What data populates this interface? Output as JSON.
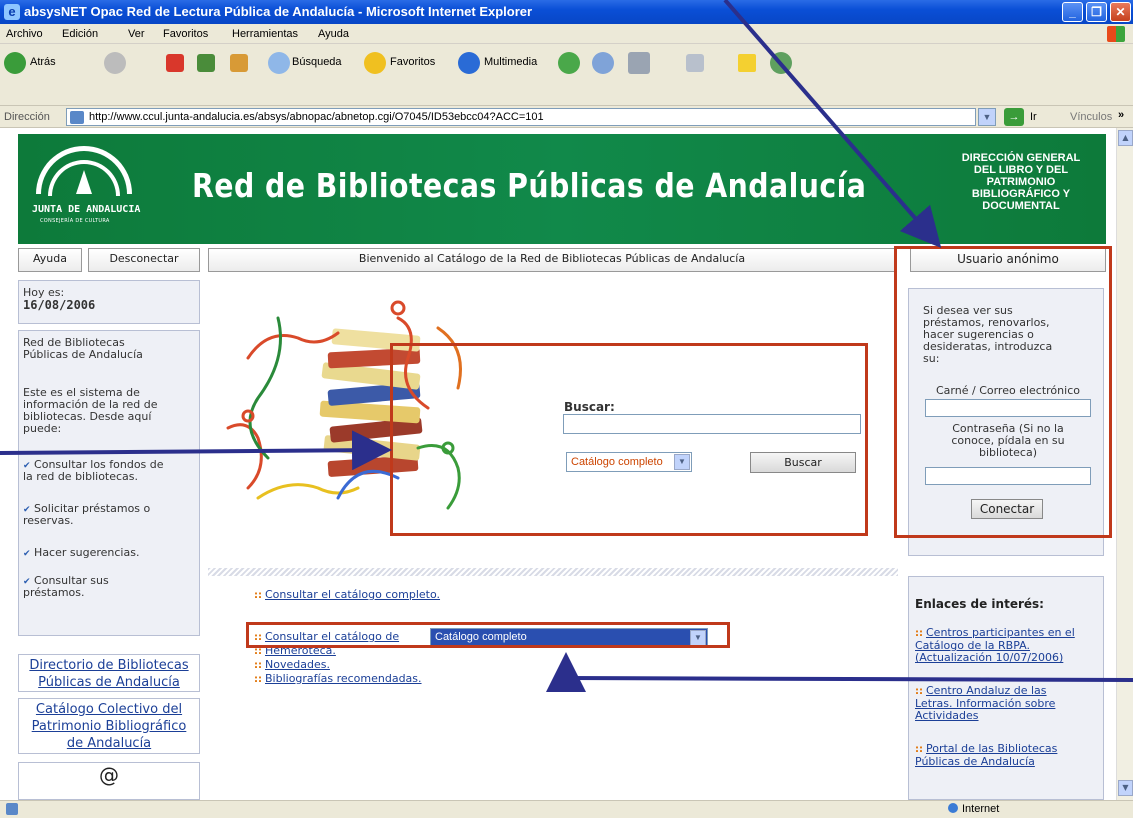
{
  "window": {
    "title": "absysNET Opac Red de Lectura Pública de Andalucía - Microsoft Internet Explorer",
    "minimize_glyph": "_",
    "restore_glyph": "❐",
    "close_glyph": "✕"
  },
  "menu": [
    "Archivo",
    "Edición",
    "Ver",
    "Favoritos",
    "Herramientas",
    "Ayuda"
  ],
  "toolbar": {
    "back": "Atrás",
    "search": "Búsqueda",
    "favorites": "Favoritos",
    "multimedia": "Multimedia"
  },
  "address": {
    "label": "Dirección",
    "url": "http://www.ccul.junta-andalucia.es/absys/abnopac/abnetop.cgi/O7045/ID53ebcc04?ACC=101",
    "go": "Ir",
    "links": "Vínculos",
    "more": "»"
  },
  "banner": {
    "logo_name": "JUNTA DE ANDALUCIA",
    "logo_sub": "CONSEJERÍA DE CULTURA",
    "title": "Red de Bibliotecas Públicas de Andalucía",
    "department": [
      "DIRECCIÓN GENERAL",
      "DEL LIBRO Y DEL",
      "PATRIMONIO",
      "BIBLIOGRÁFICO Y",
      "DOCUMENTAL"
    ]
  },
  "nav": {
    "help": "Ayuda",
    "logout": "Desconectar",
    "welcome": "Bienvenido al Catálogo de la Red de Bibliotecas Públicas de Andalucía",
    "user": "Usuario anónimo"
  },
  "left": {
    "today_label": "Hoy es:",
    "date": "16/08/2006",
    "network_name": [
      "Red de Bibliotecas",
      "Públicas de Andalucía"
    ],
    "intro": [
      "Este es el sistema de",
      "información de la red de",
      "bibliotecas. Desde aquí",
      "puede:"
    ],
    "features": [
      [
        "Consultar los fondos de",
        "la red de bibliotecas."
      ],
      [
        "Solicitar préstamos o",
        "reservas."
      ],
      [
        "Hacer sugerencias."
      ],
      [
        "Consultar sus",
        "préstamos."
      ]
    ],
    "tick": "✔",
    "directory_link": [
      "Directorio de Bibliotecas",
      "Públicas de Andalucía"
    ],
    "collective_link": [
      "Catálogo Colectivo del",
      "Patrimonio Bibliográfico",
      "de Andalucía"
    ],
    "at_symbol": "@"
  },
  "search": {
    "label": "Buscar:",
    "input_value": "",
    "catalog_option": "Catálogo completo",
    "button": "Buscar"
  },
  "center_links": {
    "bullet": "::",
    "full_catalog": "Consultar el catálogo completo.",
    "catalog_of": "Consultar el catálogo de",
    "catalog_of_select": "Catálogo completo",
    "newspaper": "Hemeroteca.",
    "news": "Novedades.",
    "bibliographies": "Bibliografías recomendadas."
  },
  "login": {
    "intro": [
      "Si desea ver sus",
      "préstamos, renovarlos,",
      "hacer sugerencias o",
      "desideratas, introduzca",
      "su:"
    ],
    "card_label": "Carné / Correo electrónico",
    "password_label": [
      "Contraseña (Si no la",
      "conoce, pídala en su",
      "biblioteca)"
    ],
    "connect": "Conectar"
  },
  "links_of_interest": {
    "heading": "Enlaces de interés:",
    "bullet": "::",
    "items": [
      [
        "Centros participantes en el",
        "Catálogo de la RBPA.",
        "(Actualización 10/07/2006)"
      ],
      [
        "Centro Andaluz de las",
        "Letras. Información sobre",
        "Actividades"
      ],
      [
        "Portal de las Bibliotecas",
        "Públicas de Andalucía"
      ]
    ]
  },
  "status": {
    "zone": "Internet"
  },
  "colors": {
    "banner_green": "#11894a",
    "annotation_red": "#c0391b",
    "arrow_navy": "#2b2f8c",
    "link_blue": "#1b3f97"
  }
}
